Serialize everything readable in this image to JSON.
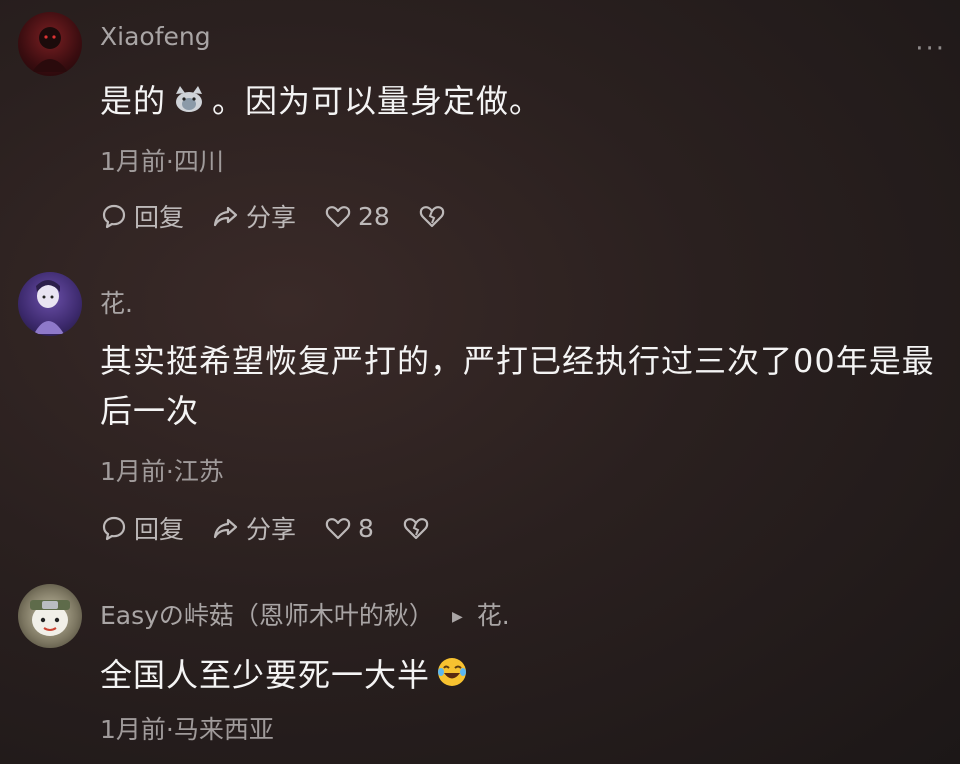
{
  "comments": [
    {
      "username": "Xiaofeng",
      "text_part1": "是的",
      "emoji": "cat-emoji",
      "text_part2": "。因为可以量身定做。",
      "meta": "1月前·四川",
      "reply_label": "回复",
      "share_label": "分享",
      "likes": "28"
    },
    {
      "username": "花.",
      "text": "其实挺希望恢复严打的，严打已经执行过三次了00年是最后一次",
      "meta": "1月前·江苏",
      "reply_label": "回复",
      "share_label": "分享",
      "likes": "8"
    },
    {
      "username": "Easyの峠菇（恩师木叶的秋）",
      "reply_to": "花.",
      "text": "全国人至少要死一大半",
      "emoji": "laughing-tears-emoji",
      "meta": "1月前·马来西亚"
    }
  ],
  "more_label": "···"
}
